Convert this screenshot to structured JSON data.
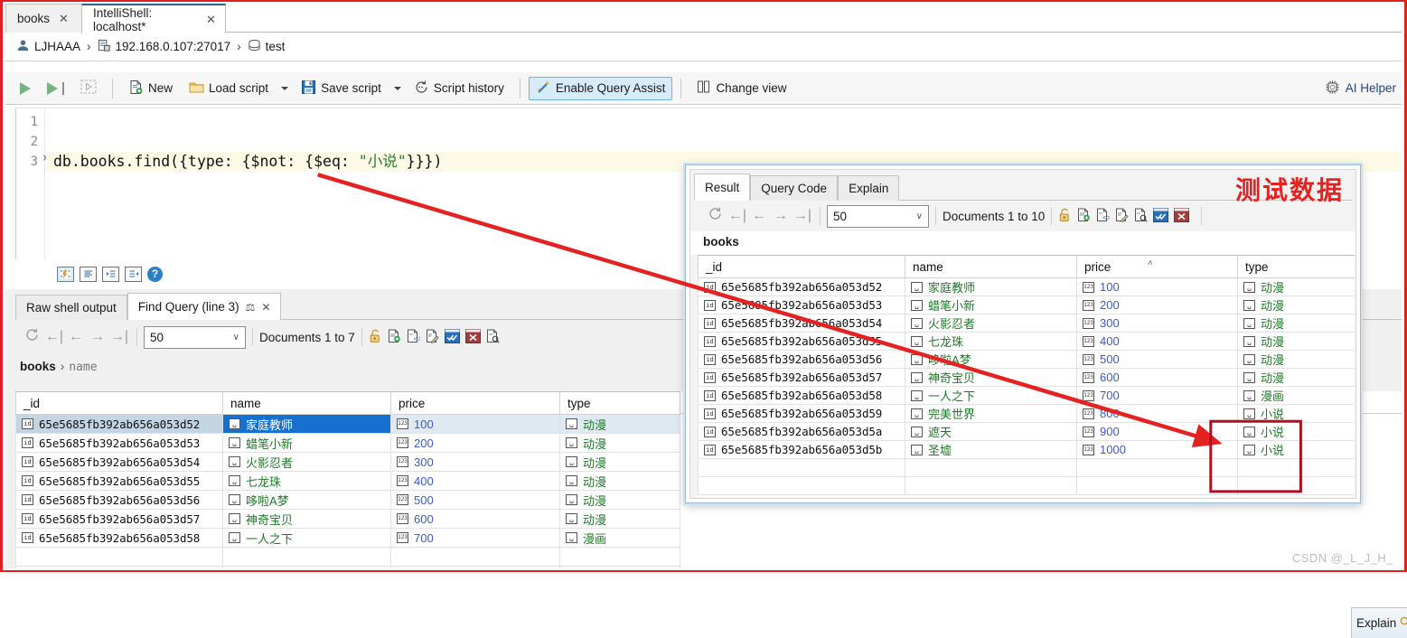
{
  "tabs": [
    {
      "label": "books",
      "close": "✕",
      "active": false
    },
    {
      "label": "IntelliShell: localhost*",
      "close": "✕",
      "active": true
    }
  ],
  "breadcrumb": {
    "user": "LJHAAA",
    "server": "192.168.0.107:27017",
    "database": "test",
    "separator": "›"
  },
  "toolbar": {
    "run_icon": "run-icon",
    "run_to_cursor_icon": "run-to-cursor-icon",
    "run_selection_icon": "run-selection-icon",
    "new_label": "New",
    "load_script_label": "Load script",
    "save_script_label": "Save script",
    "script_history_label": "Script history",
    "enable_query_assist_label": "Enable Query Assist",
    "change_view_label": "Change view",
    "ai_helper_label": "AI Helper"
  },
  "editor": {
    "line_numbers": [
      "1",
      "2",
      "3"
    ],
    "code_prefix": "db.books.find({type: {$not: {$eq: ",
    "code_string": "\"小说\"",
    "code_suffix": "}}})",
    "fold_marker": "↗"
  },
  "editor_footer": {
    "icons": [
      "format-icon",
      "align-icon",
      "indent-right-icon",
      "indent-left-icon",
      "help-icon"
    ],
    "help_glyph": "?"
  },
  "lower_panel": {
    "tabs": [
      {
        "label": "Raw shell output",
        "active": false
      },
      {
        "label": "Find Query (line 3)",
        "active": true,
        "pin": "⚖",
        "close": "✕"
      }
    ],
    "nav": {
      "refresh_icon": "refresh-icon",
      "first_icon": "←|",
      "prev_icon": "←",
      "next_icon": "→",
      "last_icon": "→|",
      "page_size": "50",
      "chevron": "∨",
      "documents_label": "Documents 1 to 7",
      "action_icons": [
        "unlock-icon",
        "add-document-icon",
        "view-json-icon",
        "edit-document-icon",
        "confirm-icon",
        "cancel-icon",
        "find-document-icon"
      ]
    },
    "collection_crumb": {
      "collection": "books",
      "arrow": "›",
      "field": "name"
    },
    "grid": {
      "columns": [
        "_id",
        "name",
        "price",
        "type"
      ],
      "rows": [
        {
          "id": "65e5685fb392ab656a053d52",
          "name": "家庭教师",
          "price": "100",
          "type": "动漫",
          "selected": true
        },
        {
          "id": "65e5685fb392ab656a053d53",
          "name": "蜡笔小新",
          "price": "200",
          "type": "动漫",
          "selected": false
        },
        {
          "id": "65e5685fb392ab656a053d54",
          "name": "火影忍者",
          "price": "300",
          "type": "动漫",
          "selected": false
        },
        {
          "id": "65e5685fb392ab656a053d55",
          "name": "七龙珠",
          "price": "400",
          "type": "动漫",
          "selected": false
        },
        {
          "id": "65e5685fb392ab656a053d56",
          "name": "哆啦A梦",
          "price": "500",
          "type": "动漫",
          "selected": false
        },
        {
          "id": "65e5685fb392ab656a053d57",
          "name": "神奇宝贝",
          "price": "600",
          "type": "动漫",
          "selected": false
        },
        {
          "id": "65e5685fb392ab656a053d58",
          "name": "一人之下",
          "price": "700",
          "type": "漫画",
          "selected": false
        }
      ]
    },
    "explain_peek_label": "Explain"
  },
  "overlay": {
    "tabs": [
      {
        "label": "Result",
        "active": true
      },
      {
        "label": "Query Code",
        "active": false
      },
      {
        "label": "Explain",
        "active": false
      }
    ],
    "nav": {
      "refresh_icon": "refresh-icon",
      "first_icon": "←|",
      "prev_icon": "←",
      "next_icon": "→",
      "last_icon": "→|",
      "page_size": "50",
      "chevron": "∨",
      "documents_label": "Documents 1 to 10",
      "action_icons": [
        "unlock-icon",
        "add-document-icon",
        "view-json-icon",
        "edit-document-icon",
        "find-document-icon",
        "confirm-icon",
        "cancel-icon"
      ]
    },
    "collection_crumb": {
      "collection": "books"
    },
    "watermark": "测试数据",
    "grid": {
      "columns": [
        "_id",
        "name",
        "price",
        "type"
      ],
      "sort_indicator": "˄",
      "rows": [
        {
          "id": "65e5685fb392ab656a053d52",
          "name": "家庭教师",
          "price": "100",
          "type": "动漫"
        },
        {
          "id": "65e5685fb392ab656a053d53",
          "name": "蜡笔小新",
          "price": "200",
          "type": "动漫"
        },
        {
          "id": "65e5685fb392ab656a053d54",
          "name": "火影忍者",
          "price": "300",
          "type": "动漫"
        },
        {
          "id": "65e5685fb392ab656a053d55",
          "name": "七龙珠",
          "price": "400",
          "type": "动漫"
        },
        {
          "id": "65e5685fb392ab656a053d56",
          "name": "哆啦A梦",
          "price": "500",
          "type": "动漫"
        },
        {
          "id": "65e5685fb392ab656a053d57",
          "name": "神奇宝贝",
          "price": "600",
          "type": "动漫"
        },
        {
          "id": "65e5685fb392ab656a053d58",
          "name": "一人之下",
          "price": "700",
          "type": "漫画"
        },
        {
          "id": "65e5685fb392ab656a053d59",
          "name": "完美世界",
          "price": "800",
          "type": "小说"
        },
        {
          "id": "65e5685fb392ab656a053d5a",
          "name": "遮天",
          "price": "900",
          "type": "小说"
        },
        {
          "id": "65e5685fb392ab656a053d5b",
          "name": "圣墟",
          "price": "1000",
          "type": "小说"
        }
      ]
    }
  },
  "annotations": {
    "arrow_color": "#e52222",
    "highlight_box_color": "#b01020"
  },
  "footer_watermark": "CSDN @_L_J_H_",
  "colors": {
    "accent_blue": "#1670d0",
    "string_green": "#1f7a28",
    "number_blue": "#3a5ad0",
    "red_annotation": "#e52222",
    "toggle_bg": "#d6ecfb"
  }
}
